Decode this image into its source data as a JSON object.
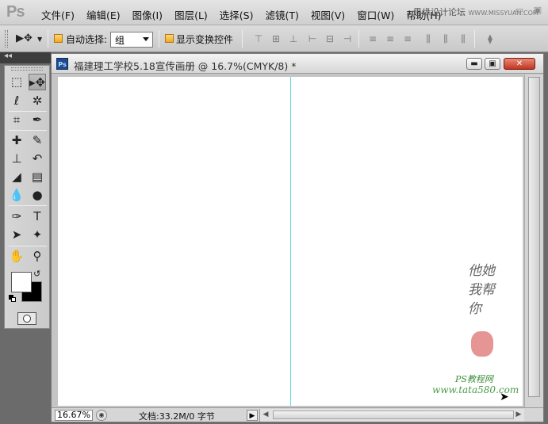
{
  "app": {
    "logo": "Ps"
  },
  "menu": [
    "文件(F)",
    "编辑(E)",
    "图像(I)",
    "图层(L)",
    "选择(S)",
    "滤镜(T)",
    "视图(V)",
    "窗口(W)",
    "帮助(H)"
  ],
  "watermark": {
    "text": "思缘设计论坛",
    "url": "WWW.MISSYUAN.COM"
  },
  "options": {
    "auto_select_label": "自动选择:",
    "auto_select_value": "组",
    "show_transform_label": "显示变换控件"
  },
  "document": {
    "title": "福建理工学校5.18宣传画册 @ 16.7%(CMYK/8) *",
    "zoom": "16.67%",
    "doc_info": "文档:33.2M/0 字节"
  },
  "overlay": {
    "signature": "他她我帮你",
    "brand": "PS教程网",
    "brand_url": "www.tata580.com"
  },
  "colors": {
    "foreground": "#ffffff",
    "background": "#000000",
    "guide": "#5fd6e8"
  }
}
